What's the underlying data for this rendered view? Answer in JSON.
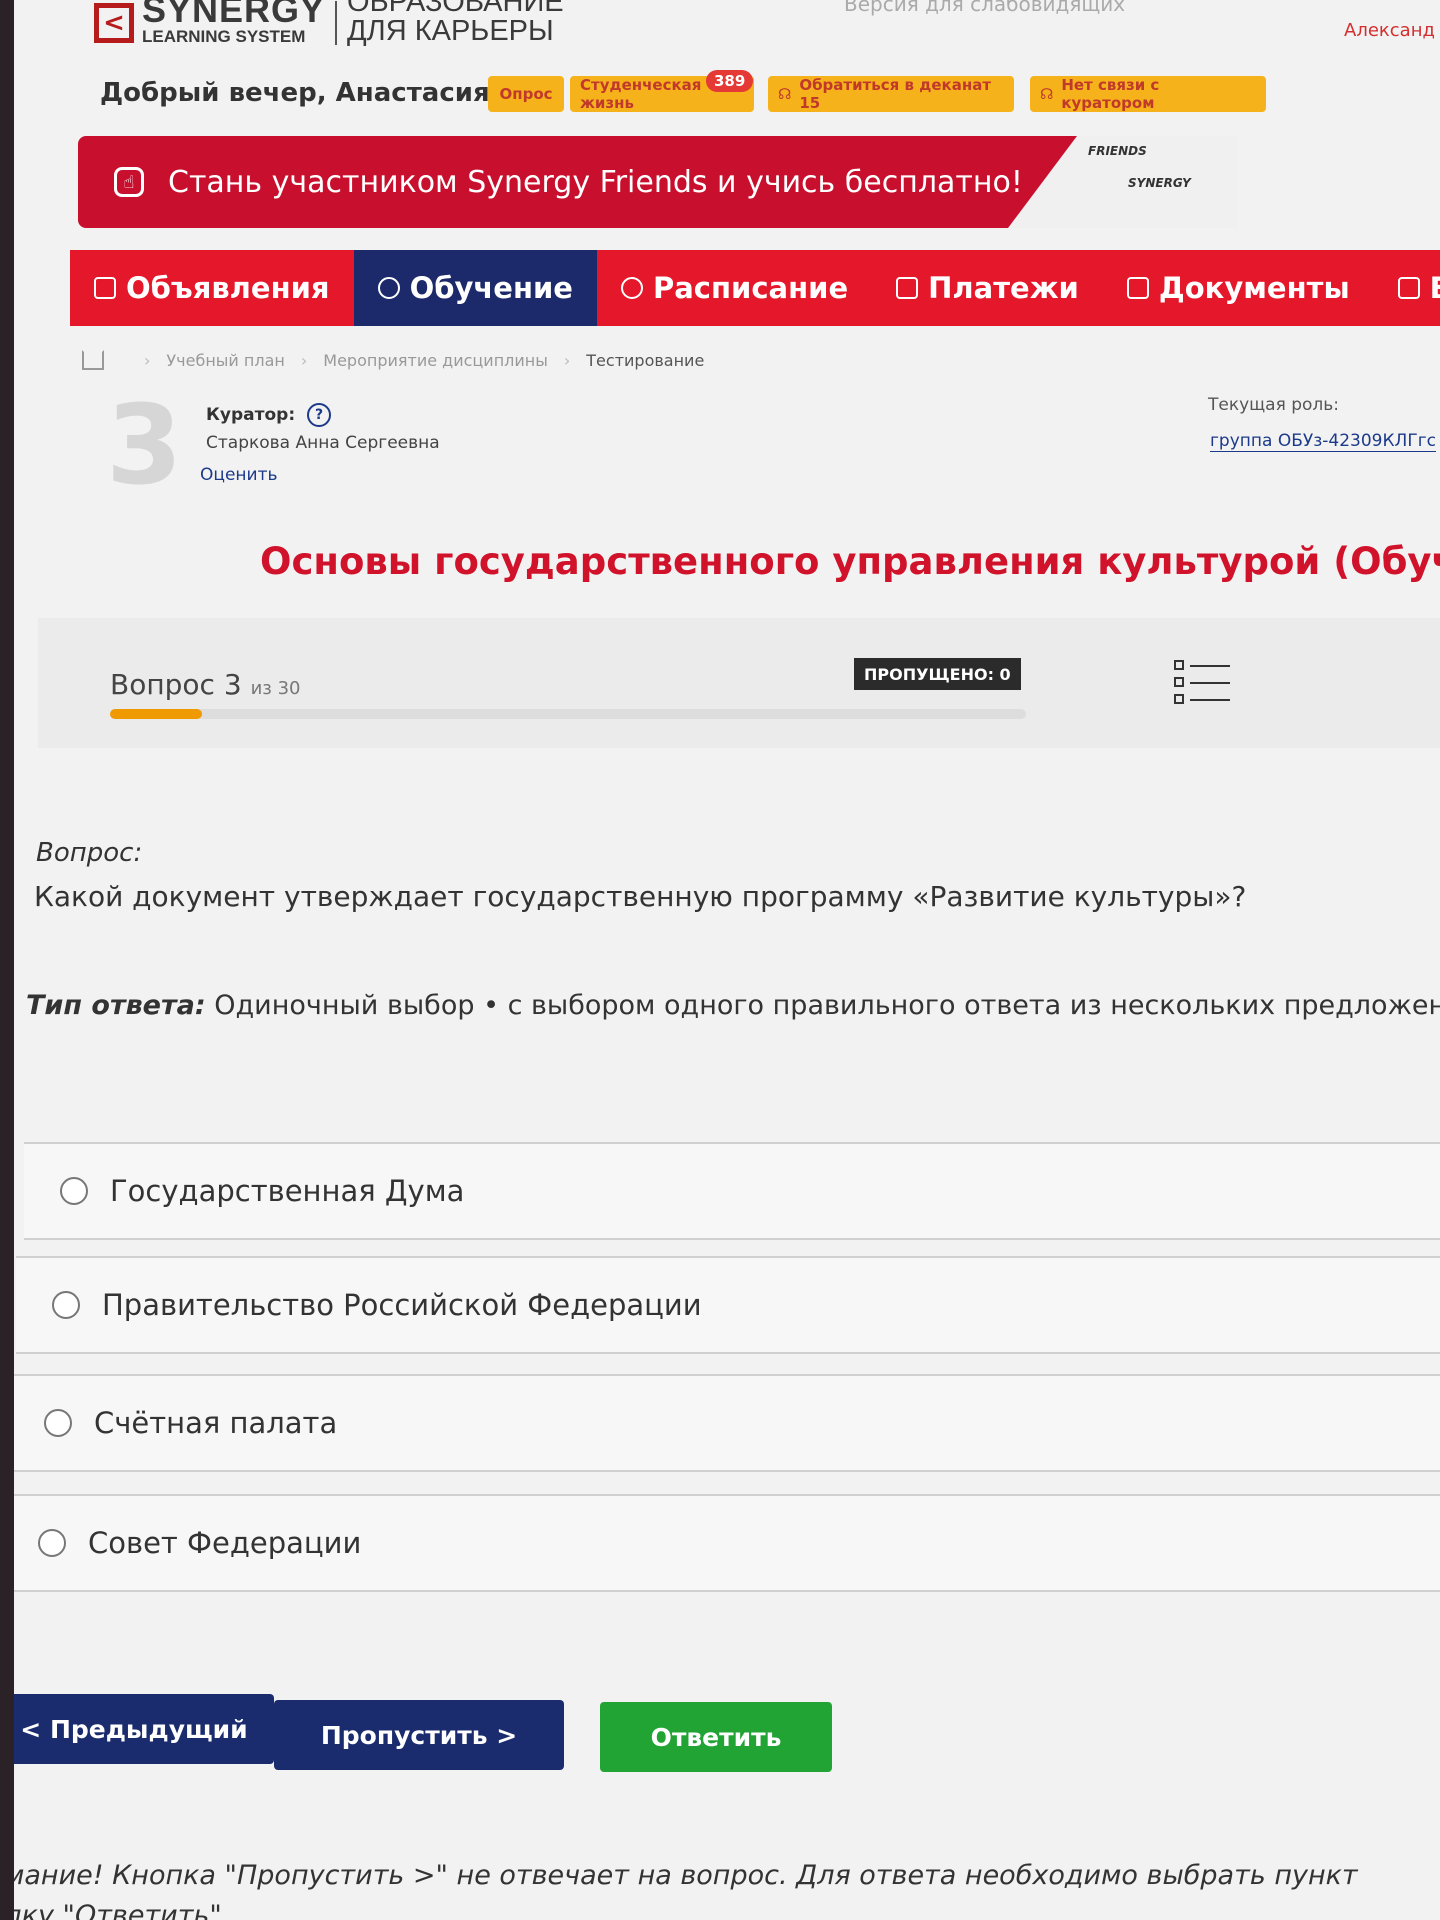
{
  "header": {
    "logo_main": "SYNERGY",
    "logo_sub": "LEARNING SYSTEM",
    "slogan_line1": "ОБРАЗОВАНИЕ",
    "slogan_line2": "ДЛЯ КАРЬЕРЫ",
    "version_link": "Версия для слабовидящих",
    "user_name": "Александ"
  },
  "greeting": "Добрый вечер, Анастасия!",
  "pills": {
    "survey": "Опрос",
    "student_life": "Студенческая жизнь",
    "student_life_badge": "389",
    "dean": "Обратиться в деканат 15",
    "curator": "Нет связи с куратором"
  },
  "banner": {
    "text": "Стань участником Synergy Friends и учись бесплатно!",
    "deco1": "FRIENDS",
    "deco2": "SYNERGY"
  },
  "nav": {
    "items": [
      {
        "label": "Объявления"
      },
      {
        "label": "Обучение"
      },
      {
        "label": "Расписание"
      },
      {
        "label": "Платежи"
      },
      {
        "label": "Документы"
      },
      {
        "label": "Биб"
      }
    ]
  },
  "breadcrumb": {
    "items": [
      "Учебный план",
      "Мероприятие дисциплины",
      "Тестирование"
    ]
  },
  "curator": {
    "avatar_char": "3",
    "label": "Куратор:",
    "help": "?",
    "name": "Старкова Анна Сергеевна",
    "rate": "Оценить",
    "role_label": "Текущая роль:",
    "role_value": "группа ОБУз-42309КЛГгс"
  },
  "course_title": "Основы государственного управления культурой (Обучени",
  "progress": {
    "question_label": "Вопрос 3",
    "of_label": "из 30",
    "current": 3,
    "total": 30,
    "skipped": "ПРОПУЩЕНО: 0"
  },
  "question": {
    "label": "Вопрос:",
    "text": "Какой документ утверждает государственную программу «Развитие культуры»?"
  },
  "answer_type": {
    "label": "Тип ответа:",
    "value": "Одиночный выбор • с выбором одного правильного ответа из нескольких предложенных ва"
  },
  "options": [
    {
      "label": "Государственная Дума"
    },
    {
      "label": "Правительство Российской Федерации"
    },
    {
      "label": "Счётная палата"
    },
    {
      "label": "Совет Федерации"
    }
  ],
  "buttons": {
    "prev": "< Предыдущий",
    "skip": "Пропустить >",
    "answer": "Ответить"
  },
  "notice": {
    "line1": "мание! Кнопка \"Пропустить >\" не отвечает на вопрос. Для ответа необходимо выбрать пункт",
    "line2": "пку \"Ответить\"."
  },
  "colors": {
    "brand_red": "#e5172a",
    "nav_active": "#1c2a6b",
    "answer_green": "#21a434",
    "progress_orange": "#ef9a00"
  }
}
